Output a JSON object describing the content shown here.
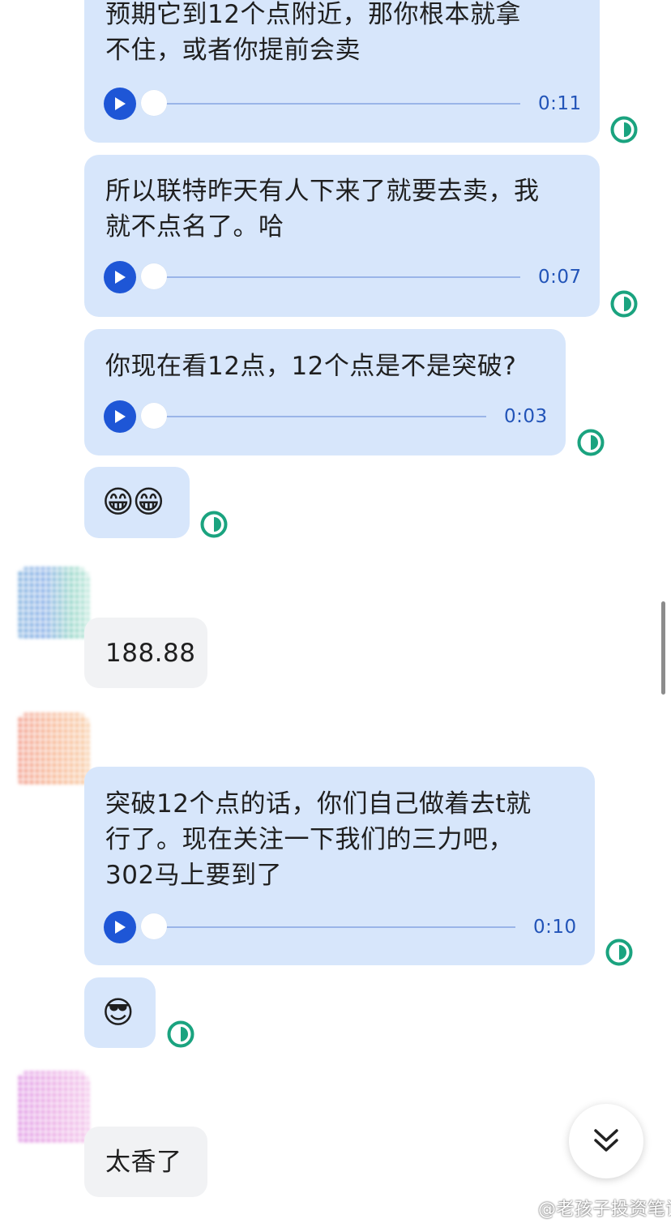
{
  "messages": [
    {
      "text": "预期它到12个点附近，那你根本就拿\n不住，或者你提前会卖",
      "duration": "0:11"
    },
    {
      "text": "所以联特昨天有人下来了就要去卖，我\n就不点名了。哈",
      "duration": "0:07"
    },
    {
      "text": "你现在看12点，12个点是不是突破?",
      "duration": "0:03"
    },
    {
      "emoji": "😁😁"
    },
    {
      "text": "188.88"
    },
    {
      "text": "突破12个点的话，你们自己做着去t就\n行了。现在关注一下我们的三力吧，\n302马上要到了",
      "duration": "0:10"
    },
    {
      "emoji": "😎"
    },
    {
      "text": "太香了"
    }
  ],
  "watermark": "@老孩子投资笔记",
  "colors": {
    "self_bubble": "#d7e6fb",
    "other_bubble": "#f1f2f4",
    "play_button": "#1e56d6",
    "status_ring": "#1aa37f"
  },
  "icons": {
    "play": "play-icon",
    "status": "read-status-icon",
    "scroll_down": "chevron-double-down-icon",
    "watermark_logo": "weibo-logo-icon"
  }
}
